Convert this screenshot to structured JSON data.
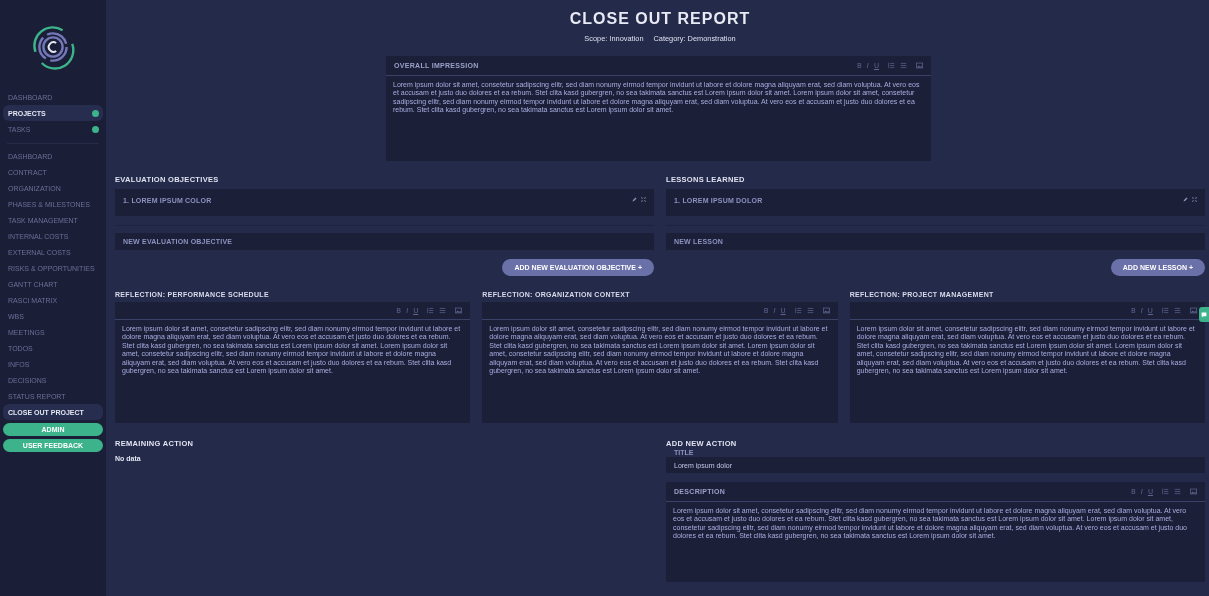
{
  "sidebar": {
    "top_items": [
      {
        "label": "DASHBOARD",
        "selected": false,
        "badge": false
      },
      {
        "label": "PROJECTS",
        "selected": true,
        "badge": true
      },
      {
        "label": "TASKS",
        "selected": false,
        "badge": true
      }
    ],
    "project_items": [
      {
        "label": "DASHBOARD",
        "selected": false
      },
      {
        "label": "CONTRACT",
        "selected": false
      },
      {
        "label": "ORGANIZATION",
        "selected": false
      },
      {
        "label": "PHASES & MILESTONES",
        "selected": false
      },
      {
        "label": "TASK MANAGEMENT",
        "selected": false
      },
      {
        "label": "INTERNAL COSTS",
        "selected": false
      },
      {
        "label": "EXTERNAL COSTS",
        "selected": false
      },
      {
        "label": "RISKS & OPPORTUNITIES",
        "selected": false
      },
      {
        "label": "GANTT CHART",
        "selected": false
      },
      {
        "label": "RASCI MATRIX",
        "selected": false
      },
      {
        "label": "WBS",
        "selected": false
      },
      {
        "label": "MEETINGS",
        "selected": false
      },
      {
        "label": "TODOS",
        "selected": false
      },
      {
        "label": "INFOS",
        "selected": false
      },
      {
        "label": "DECISIONS",
        "selected": false
      },
      {
        "label": "STATUS REPORT",
        "selected": false
      },
      {
        "label": "CLOSE OUT PROJECT",
        "selected": true
      }
    ],
    "buttons": [
      "ADMIN",
      "USER FEEDBACK"
    ]
  },
  "header": {
    "title": "CLOSE OUT REPORT",
    "scope": "Scope: Innovation",
    "category": "Category: Demonstration"
  },
  "overall_impression": {
    "label": "OVERALL IMPRESSION",
    "format_buttons": [
      "B",
      "I",
      "U"
    ],
    "text": "Lorem ipsum dolor sit amet, consetetur sadipscing elitr, sed diam nonumy eirmod tempor invidunt ut labore et dolore magna aliquyam erat, sed diam voluptua. At vero eos et accusam et justo duo dolores et ea rebum. Stet clita kasd gubergren, no sea takimata sanctus est Lorem ipsum dolor sit amet. Lorem ipsum dolor sit amet, consetetur sadipscing elitr, sed diam nonumy eirmod tempor invidunt ut labore et dolore magna aliquyam erat, sed diam voluptua. At vero eos et accusam et justo duo dolores et ea rebum. Stet clita kasd gubergren, no sea takimata sanctus est Lorem ipsum dolor sit amet."
  },
  "lists": [
    {
      "heading": "EVALUATION OBJECTIVES",
      "items": [
        "1. LOREM IPSUM COLOR"
      ],
      "new_placeholder": "NEW EVALUATION OBJECTIVE",
      "add_button": "ADD NEW EVALUATION OBJECTIVE +"
    },
    {
      "heading": "LESSONS LEARNED",
      "items": [
        "1. LOREM IPSUM DOLOR"
      ],
      "new_placeholder": "NEW LESSON",
      "add_button": "ADD NEW LESSON +"
    }
  ],
  "reflections": [
    {
      "heading": "REFLECTION: PERFORMANCE SCHEDULE",
      "format_buttons": [
        "B",
        "I",
        "U"
      ],
      "text": "Lorem ipsum dolor sit amet, consetetur sadipscing elitr, sed diam nonumy eirmod tempor invidunt ut labore et dolore magna aliquyam erat, sed diam voluptua. At vero eos et accusam et justo duo dolores et ea rebum. Stet clita kasd gubergren, no sea takimata sanctus est Lorem ipsum dolor sit amet. Lorem ipsum dolor sit amet, consetetur sadipscing elitr, sed diam nonumy eirmod tempor invidunt ut labore et dolore magna aliquyam erat, sed diam voluptua. At vero eos et accusam et justo duo dolores et ea rebum. Stet clita kasd gubergren, no sea takimata sanctus est Lorem ipsum dolor sit amet."
    },
    {
      "heading": "REFLECTION: ORGANIZATION CONTEXT",
      "format_buttons": [
        "B",
        "I",
        "U"
      ],
      "text": "Lorem ipsum dolor sit amet, consetetur sadipscing elitr, sed diam nonumy eirmod tempor invidunt ut labore et dolore magna aliquyam erat, sed diam voluptua. At vero eos et accusam et justo duo dolores et ea rebum. Stet clita kasd gubergren, no sea takimata sanctus est Lorem ipsum dolor sit amet. Lorem ipsum dolor sit amet, consetetur sadipscing elitr, sed diam nonumy eirmod tempor invidunt ut labore et dolore magna aliquyam erat, sed diam voluptua. At vero eos et accusam et justo duo dolores et ea rebum. Stet clita kasd gubergren, no sea takimata sanctus est Lorem ipsum dolor sit amet."
    },
    {
      "heading": "REFLECTION: PROJECT MANAGEMENT",
      "format_buttons": [
        "B",
        "I",
        "U"
      ],
      "text": "Lorem ipsum dolor sit amet, consetetur sadipscing elitr, sed diam nonumy eirmod tempor invidunt ut labore et dolore magna aliquyam erat, sed diam voluptua. At vero eos et accusam et justo duo dolores et ea rebum. Stet clita kasd gubergren, no sea takimata sanctus est Lorem ipsum dolor sit amet. Lorem ipsum dolor sit amet, consetetur sadipscing elitr, sed diam nonumy eirmod tempor invidunt ut labore et dolore magna aliquyam erat, sed diam voluptua. At vero eos et accusam et justo duo dolores et ea rebum. Stet clita kasd gubergren, no sea takimata sanctus est Lorem ipsum dolor sit amet."
    }
  ],
  "remaining_action": {
    "heading": "REMAINING ACTION",
    "empty_text": "No data"
  },
  "add_new_action": {
    "heading": "ADD NEW ACTION",
    "title_label": "TITLE",
    "title_value": "Lorem ipsum dolor",
    "description_label": "DESCRIPTION",
    "format_buttons": [
      "B",
      "I",
      "U"
    ],
    "text": "Lorem ipsum dolor sit amet, consetetur sadipscing elitr, sed diam nonumy eirmod tempor invidunt ut labore et dolore magna aliquyam erat, sed diam voluptua. At vero eos et accusam et justo duo dolores et ea rebum. Stet clita kasd gubergren, no sea takimata sanctus est Lorem ipsum dolor sit amet. Lorem ipsum dolor sit amet, consetetur sadipscing elitr, sed diam nonumy eirmod tempor invidunt ut labore et dolore magna aliquyam erat, sed diam voluptua. At vero eos et accusam et justo duo dolores et ea rebum. Stet clita kasd gubergren, no sea takimata sanctus est Lorem ipsum dolor sit amet."
  }
}
